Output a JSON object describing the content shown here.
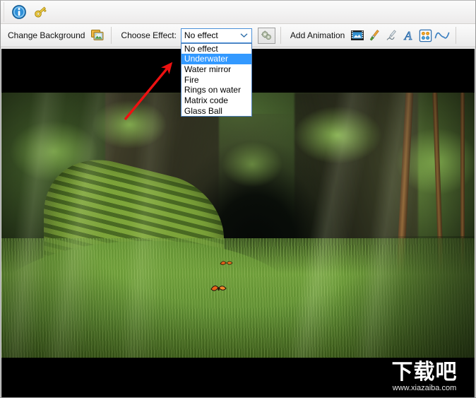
{
  "window": {
    "background_color": "#f0f0f0"
  },
  "topbar": {
    "icons": [
      {
        "name": "info-icon",
        "label": "Info"
      },
      {
        "name": "key-icon",
        "label": "Register"
      }
    ]
  },
  "toolbar": {
    "change_background_label": "Change Background",
    "change_background_icon": "image-swap-icon",
    "choose_effect_label": "Choose Effect:",
    "effect_combo": {
      "value": "No effect",
      "expanded": true,
      "highlighted": "Underwater",
      "options": [
        "No effect",
        "Underwater",
        "Water mirror",
        "Fire",
        "Rings on water",
        "Matrix code",
        "Glass Ball"
      ]
    },
    "effect_settings_icon": "gears-icon",
    "add_animation_label": "Add Animation",
    "animation_icons": [
      {
        "name": "film-strip-icon",
        "label": "Video animation"
      },
      {
        "name": "paintbrush-icon",
        "label": "Brush animation"
      },
      {
        "name": "pen-nib-icon",
        "label": "Pen animation"
      },
      {
        "name": "text-a-icon",
        "label": "Text animation"
      },
      {
        "name": "particles-icon",
        "label": "Particles animation"
      },
      {
        "name": "wave-curve-icon",
        "label": "Wave animation"
      }
    ]
  },
  "canvas": {
    "letterbox_color": "#000000",
    "scene_description": "Jungle forest with mossy stone stairs, cave and sunbeams"
  },
  "annotation": {
    "arrow_color": "#ee1111",
    "points_to": "Underwater"
  },
  "watermark": {
    "title": "下载吧",
    "url": "www.xiazaiba.com"
  },
  "colors": {
    "accent": "#3399ff",
    "combo_border": "#4a90d9",
    "toolbar_bg": "#f2f2f2"
  }
}
